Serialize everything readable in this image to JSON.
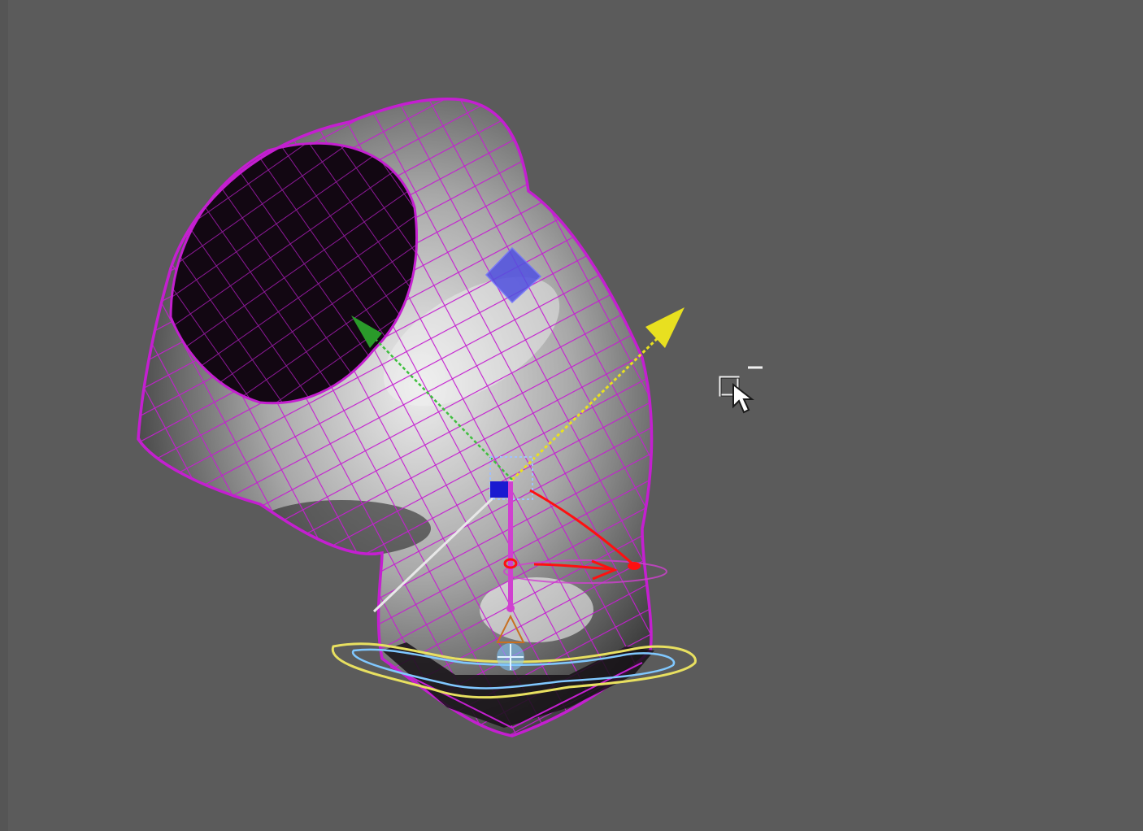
{
  "viewport": {
    "background": "#5b5b5b",
    "mesh_wire_color": "#c41fd0",
    "mesh_shade_dark": "#1a0c1c",
    "mesh_shade_light": "#d8d8d8"
  },
  "gizmo": {
    "axis_y_color": "#3fbf3f",
    "axis_z_color": "#e8e020",
    "axis_x_color": "#e8e8e8",
    "plane_handle_color": "#5050e0",
    "center_handle_color": "#2020c0",
    "base_ring_color": "#e8e060",
    "inner_ring_color": "#80c8ff"
  },
  "annotation": {
    "color": "#ff1010"
  },
  "cursor": {
    "icon": "region-select-cursor-icon",
    "badge": "−"
  }
}
